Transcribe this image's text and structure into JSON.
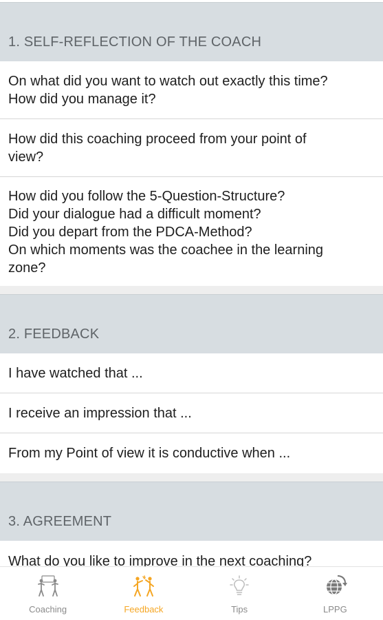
{
  "sections": [
    {
      "header": "1. SELF-REFLECTION OF THE COACH",
      "items": [
        "On what did you want to watch out exactly this time?\nHow did you manage it?",
        "How did this coaching proceed from your point of\nview?",
        "How did you follow the 5-Question-Structure?\nDid your dialogue had a difficult moment?\nDid you depart from the PDCA-Method?\nOn which moments was the coachee in the learning\nzone?"
      ]
    },
    {
      "header": "2. FEEDBACK",
      "items": [
        "I have watched that ...",
        "I receive an impression that ...",
        "From my Point of view it is conductive when ..."
      ]
    },
    {
      "header": "3. AGREEMENT",
      "items": [
        "What do you like to improve in the next coaching?"
      ]
    }
  ],
  "nav": {
    "items": [
      {
        "label": "Coaching",
        "icon": "coaching-icon",
        "active": false
      },
      {
        "label": "Feedback",
        "icon": "feedback-icon",
        "active": true
      },
      {
        "label": "Tips",
        "icon": "lightbulb-icon",
        "active": false
      },
      {
        "label": "LPPG",
        "icon": "globe-arrow-icon",
        "active": false
      }
    ]
  },
  "colors": {
    "active": "#f5a623",
    "inactive": "#8a8a8a",
    "section_header_bg": "#d7dde1"
  }
}
